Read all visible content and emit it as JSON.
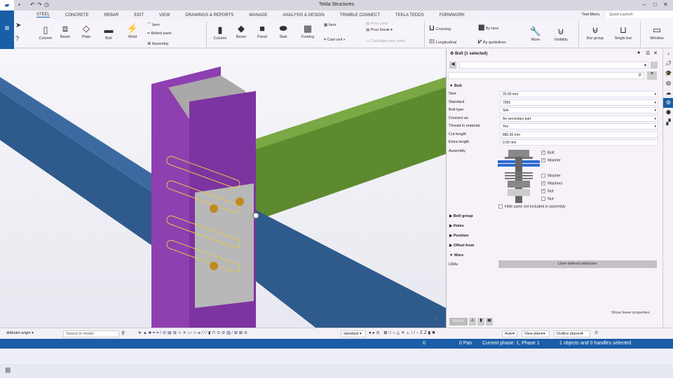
{
  "app": {
    "title": "Tekla Structures"
  },
  "tabs": [
    "STEEL",
    "CONCRETE",
    "REBAR",
    "EDIT",
    "VIEW",
    "DRAWINGS & REPORTS",
    "MANAGE",
    "ANALYSIS & DESIGN",
    "TRIMBLE CONNECT",
    "TEKLA TEDDS",
    "FORMWORK"
  ],
  "top_right": {
    "test_menu": "Test Menu",
    "quick_launch": "Quick Launch"
  },
  "ribbon": {
    "steel": {
      "column": "Column",
      "beam": "Beam",
      "plate": "Plate",
      "bolt": "Bolt",
      "weld": "Weld",
      "item": "Item",
      "bolted_parts": "Bolted parts",
      "assembly": "Assembly"
    },
    "concrete": {
      "column": "Column",
      "beam": "Beam",
      "panel": "Panel",
      "slab": "Slab",
      "footing": "Footing",
      "item": "Item",
      "cast_unit": "Cast unit",
      "pour_view": "Pour view",
      "pour_break": "Pour break",
      "calculate_pour_units": "Calculate pour units"
    },
    "rebar": {
      "crossing": "Crossing",
      "longitudinal": "Longitudinal",
      "by_face": "By face",
      "by_guidelines": "By guidelines",
      "more": "More",
      "visibility": "Visibility",
      "bar_group": "Bar group",
      "single_bar": "Single bar"
    },
    "window": "Window"
  },
  "panel": {
    "title": "Bolt (1 selected)",
    "section_bolt": "Bolt",
    "fields": [
      {
        "label": "Size",
        "value": "20.00 mm",
        "dropdown": true
      },
      {
        "label": "Standard",
        "value": "7990",
        "dropdown": true
      },
      {
        "label": "Bolt type",
        "value": "Site",
        "dropdown": true
      },
      {
        "label": "Connect as",
        "value": "As secondary part",
        "dropdown": true
      },
      {
        "label": "Thread in material",
        "value": "Yes",
        "dropdown": true
      },
      {
        "label": "Cut length",
        "value": "880.00 mm",
        "dropdown": false
      },
      {
        "label": "Extra length",
        "value": "0.00 mm",
        "dropdown": false
      }
    ],
    "assembly_label": "Assembly",
    "assembly": [
      {
        "label": "Bolt",
        "checked": true
      },
      {
        "label": "Washer",
        "checked": true
      },
      {
        "label": "Washer",
        "checked": false
      },
      {
        "label": "Washers",
        "checked": true
      },
      {
        "label": "Nut",
        "checked": true
      },
      {
        "label": "Nut",
        "checked": false
      }
    ],
    "hide_parts": "Hide parts not included in assembly",
    "sections": [
      "Bolt group",
      "Holes",
      "Position",
      "Offset from"
    ],
    "more": "More",
    "udas_label": "UDAs",
    "udas_button": "User-defined attributes",
    "show_fewer": "Show fewer properties",
    "modify": "Modify"
  },
  "bottombar": {
    "model_origin": "Model origin",
    "search_placeholder": "Search in model",
    "standard": "standard",
    "auto": "Auto",
    "view_plane": "View plane",
    "outline_planes": "Outline planes"
  },
  "status": {
    "zero": "0",
    "pan": "0 Pan",
    "phase": "Current phase: 1, Phase 1",
    "selection": "1 objects and 0 handles selected"
  },
  "colors": {
    "accent": "#1a5ea8",
    "column": "#8e3fb0",
    "beam": "#2f5a8c",
    "green_beam": "#5d8a2e"
  }
}
